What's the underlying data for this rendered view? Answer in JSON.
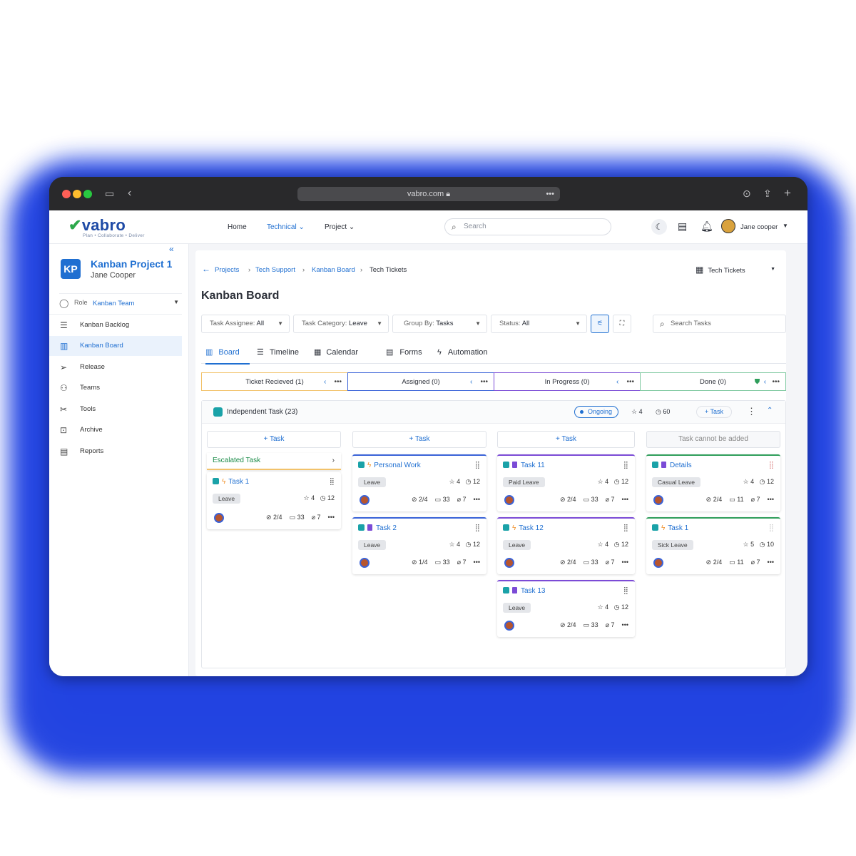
{
  "browser": {
    "url": "vabro.com"
  },
  "brand": {
    "name": "vabro",
    "tagline": "Plan • Collaborate • Deliver"
  },
  "nav": {
    "home": "Home",
    "technical": "Technical",
    "project": "Project",
    "search_placeholder": "Search",
    "user": "Jane cooper"
  },
  "sidebar": {
    "badge": "KP",
    "project_title": "Kanban Project 1",
    "project_owner": "Jane Cooper",
    "role_label": "Role",
    "role_value": "Kanban Team",
    "items": [
      {
        "label": "Kanban Backlog",
        "icon": "backlog-icon"
      },
      {
        "label": "Kanban Board",
        "icon": "board-icon"
      },
      {
        "label": "Release",
        "icon": "send-icon"
      },
      {
        "label": "Teams",
        "icon": "teams-icon"
      },
      {
        "label": "Tools",
        "icon": "tools-icon"
      },
      {
        "label": "Archive",
        "icon": "archive-icon"
      },
      {
        "label": "Reports",
        "icon": "reports-icon"
      }
    ]
  },
  "breadcrumb": [
    "Projects",
    "Tech Support",
    "Kanban Board",
    "Tech Tickets"
  ],
  "view_select": "Tech Tickets",
  "page_title": "Kanban Board",
  "filters": {
    "assignee": {
      "label": "Task Assignee:",
      "value": "All"
    },
    "category": {
      "label": "Task Category:",
      "value": "Leave"
    },
    "group": {
      "label": "Group By:",
      "value": "Tasks"
    },
    "status": {
      "label": "Status:",
      "value": "All"
    },
    "search_placeholder": "Search Tasks"
  },
  "tabs": [
    "Board",
    "Timeline",
    "Calendar",
    "Forms",
    "Automation"
  ],
  "columns": [
    "Ticket Recieved (1)",
    "Assigned (0)",
    "In Progress (0)",
    "Done (0)"
  ],
  "group": {
    "title": "Independent Task (23)",
    "status": "Ongoing",
    "stars": "4",
    "time": "60",
    "add": "+ Task"
  },
  "add_task": "+ Task",
  "cannot_add": "Task cannot be added",
  "escalated": "Escalated Task",
  "cards": {
    "c1": {
      "title": "Task 1",
      "label": "Leave",
      "stars": "4",
      "time": "12",
      "check": "2/4",
      "comments": "33",
      "attach": "7"
    },
    "c2": {
      "title": "Personal Work",
      "label": "Leave",
      "stars": "4",
      "time": "12",
      "check": "2/4",
      "comments": "33",
      "attach": "7"
    },
    "c3": {
      "title": "Task 2",
      "label": "Leave",
      "stars": "4",
      "time": "12",
      "check": "1/4",
      "comments": "33",
      "attach": "7"
    },
    "c4": {
      "title": "Task 11",
      "label": "Paid Leave",
      "stars": "4",
      "time": "12",
      "check": "2/4",
      "comments": "33",
      "attach": "7"
    },
    "c5": {
      "title": "Task 12",
      "label": "Leave",
      "stars": "4",
      "time": "12",
      "check": "2/4",
      "comments": "33",
      "attach": "7"
    },
    "c6": {
      "title": "Task 13",
      "label": "Leave",
      "stars": "4",
      "time": "12",
      "check": "2/4",
      "comments": "33",
      "attach": "7"
    },
    "c7": {
      "title": "Details",
      "label": "Casual Leave",
      "stars": "4",
      "time": "12",
      "check": "2/4",
      "comments": "11",
      "attach": "7"
    },
    "c8": {
      "title": "Task 1",
      "label": "Sick Leave",
      "stars": "5",
      "time": "10",
      "check": "2/4",
      "comments": "11",
      "attach": "7"
    }
  },
  "colors": {
    "accent": "#1f6fd1",
    "ticket": "#f2c26a",
    "assigned": "#3a63d8",
    "progress": "#7b4bd6",
    "done": "#2f9e5b"
  }
}
